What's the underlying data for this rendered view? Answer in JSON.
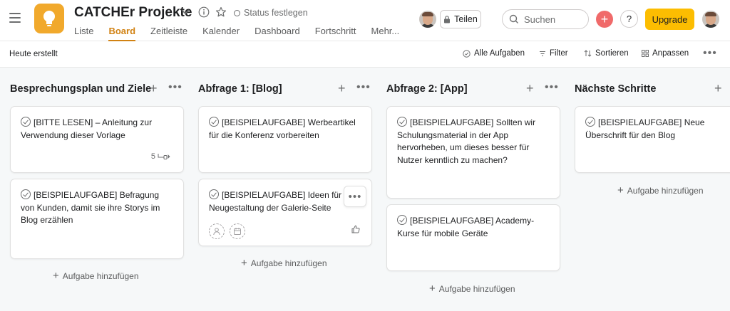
{
  "header": {
    "project_title": "CATCHEr Projekte",
    "status_label": "Status festlegen",
    "tabs": [
      {
        "label": "Liste"
      },
      {
        "label": "Board",
        "active": true
      },
      {
        "label": "Zeitleiste"
      },
      {
        "label": "Kalender"
      },
      {
        "label": "Dashboard"
      },
      {
        "label": "Fortschritt"
      },
      {
        "label": "Mehr..."
      }
    ],
    "share_label": "Teilen",
    "search_placeholder": "Suchen",
    "help_label": "?",
    "upgrade_label": "Upgrade",
    "accent_color": "#f1a92c",
    "upgrade_color": "#fcbd01",
    "plus_color": "#f06a6a"
  },
  "toolbar": {
    "created_label": "Heute erstellt",
    "all_tasks_label": "Alle Aufgaben",
    "filter_label": "Filter",
    "sort_label": "Sortieren",
    "adjust_label": "Anpassen"
  },
  "columns": [
    {
      "title": "Besprechungsplan und Ziele",
      "cards": [
        {
          "text": "[BITTE LESEN] – Anleitung zur Verwendung dieser Vorlage",
          "subtask_count": "5"
        },
        {
          "text": "[BEISPIELAUFGABE] Befragung von Kunden, damit sie ihre Storys im Blog erzählen"
        }
      ],
      "add_label": "Aufgabe hinzufügen"
    },
    {
      "title": "Abfrage 1: [Blog]",
      "cards": [
        {
          "text": "[BEISPIELAUFGABE] Werbeartikel für die Konferenz vorbereiten"
        },
        {
          "text": "[BEISPIELAUFGABE] Ideen für die Neugestaltung der Galerie-Seite"
        }
      ],
      "add_label": "Aufgabe hinzufügen"
    },
    {
      "title": "Abfrage 2: [App]",
      "cards": [
        {
          "text": "[BEISPIELAUFGABE] Sollten wir Schulungsmaterial in der App hervorheben, um dieses besser für Nutzer kenntlich zu machen?"
        },
        {
          "text": "[BEISPIELAUFGABE] Academy-Kurse für mobile Geräte"
        }
      ],
      "add_label": "Aufgabe hinzufügen"
    },
    {
      "title": "Nächste Schritte",
      "cards": [
        {
          "text": "[BEISPIELAUFGABE] Neue Überschrift für den Blog"
        }
      ],
      "add_label": "Aufgabe hinzufügen"
    }
  ]
}
